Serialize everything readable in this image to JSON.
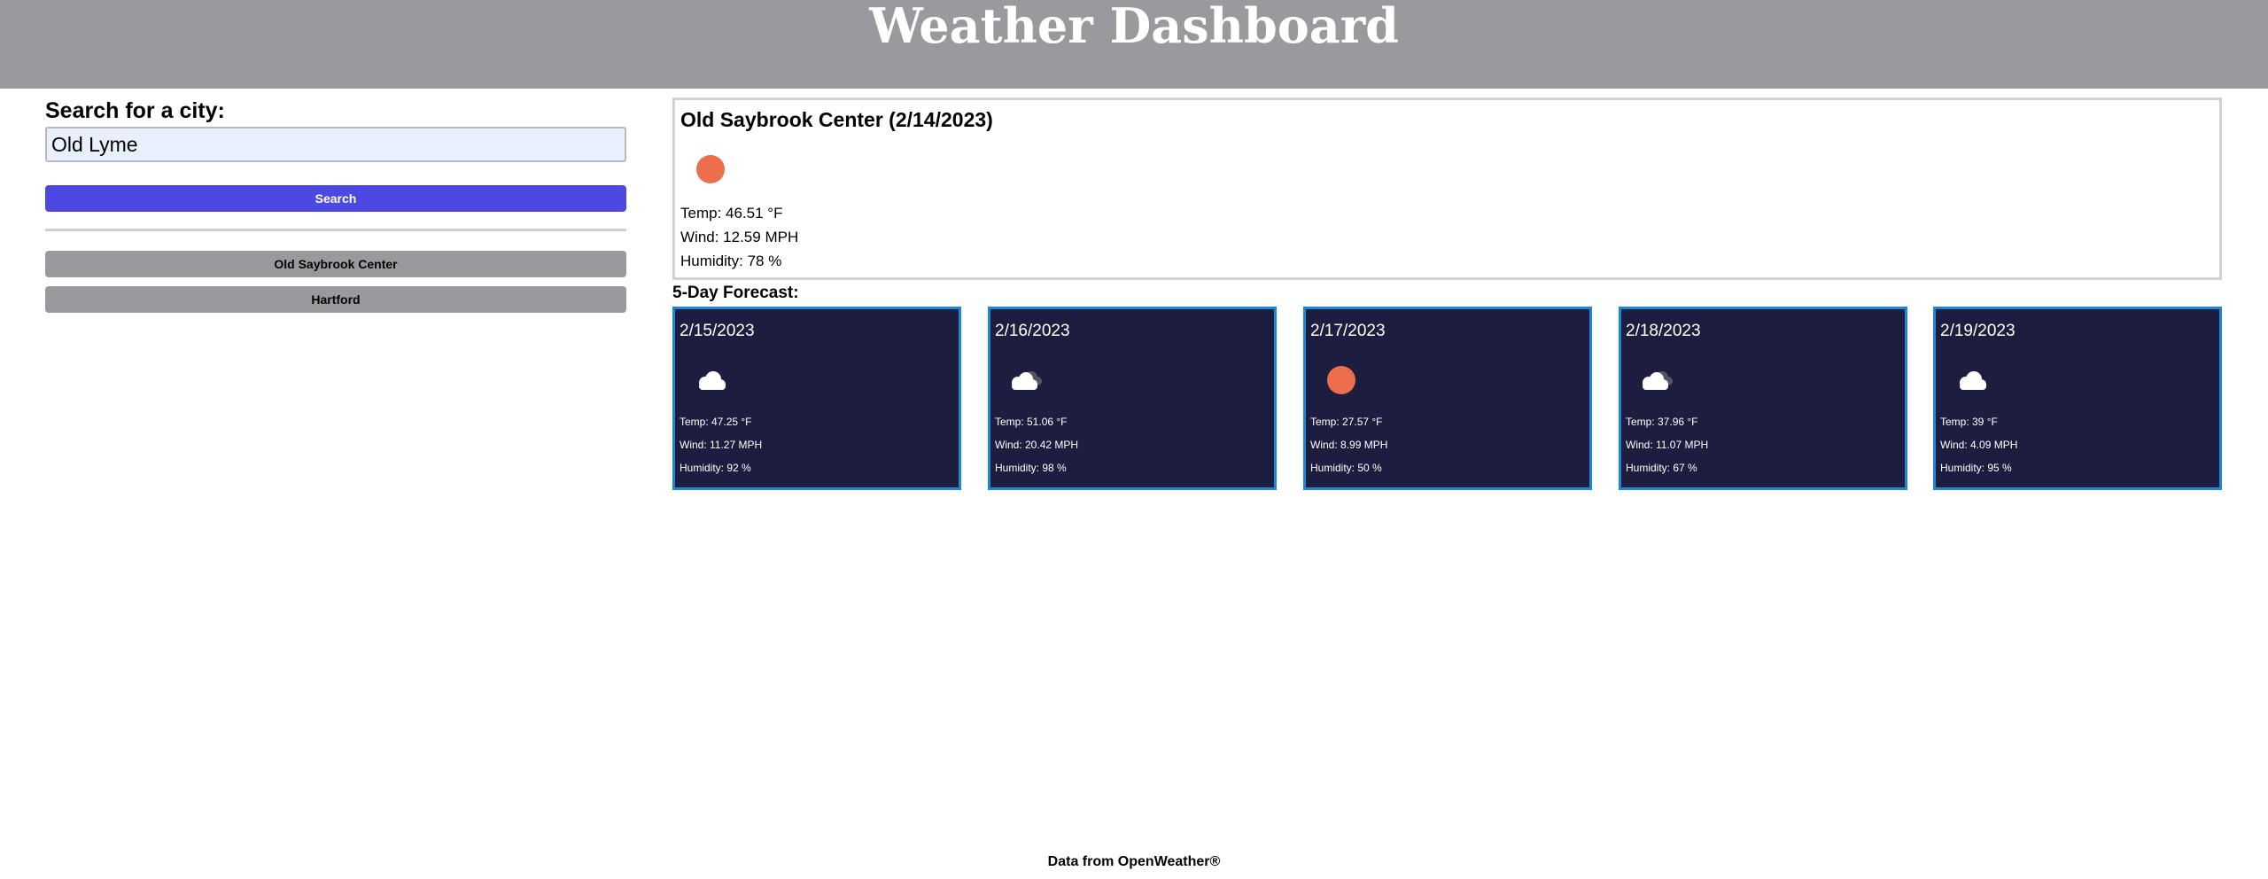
{
  "header": {
    "title": "Weather Dashboard"
  },
  "search": {
    "label": "Search for a city:",
    "input_value": "Old Lyme",
    "button_label": "Search"
  },
  "history": [
    {
      "label": "Old Saybrook Center"
    },
    {
      "label": "Hartford"
    }
  ],
  "current": {
    "city": "Old Saybrook Center",
    "date": "(2/14/2023)",
    "icon": "sun-icon",
    "temp": "Temp: 46.51 °F",
    "wind": "Wind: 12.59 MPH",
    "humidity": "Humidity: 78 %"
  },
  "forecast": {
    "heading": "5-Day Forecast:",
    "days": [
      {
        "date": "2/15/2023",
        "icon": "cloud-icon",
        "temp": "Temp: 47.25 °F",
        "wind": "Wind: 11.27 MPH",
        "humidity": "Humidity: 92 %"
      },
      {
        "date": "2/16/2023",
        "icon": "broken-clouds-icon",
        "temp": "Temp: 51.06 °F",
        "wind": "Wind: 20.42 MPH",
        "humidity": "Humidity: 98 %"
      },
      {
        "date": "2/17/2023",
        "icon": "sun-icon",
        "temp": "Temp: 27.57 °F",
        "wind": "Wind: 8.99 MPH",
        "humidity": "Humidity: 50 %"
      },
      {
        "date": "2/18/2023",
        "icon": "broken-clouds-icon",
        "temp": "Temp: 37.96 °F",
        "wind": "Wind: 11.07 MPH",
        "humidity": "Humidity: 67 %"
      },
      {
        "date": "2/19/2023",
        "icon": "cloud-icon",
        "temp": "Temp: 39 °F",
        "wind": "Wind: 4.09 MPH",
        "humidity": "Humidity: 95 %"
      }
    ]
  },
  "footer": {
    "text": "Data from OpenWeather®"
  },
  "colors": {
    "header_bg": "#9a999e",
    "search_button": "#4c49e3",
    "card_bg": "#1d1d40",
    "card_border": "#1f86d6",
    "sun": "#ec6e4c"
  }
}
